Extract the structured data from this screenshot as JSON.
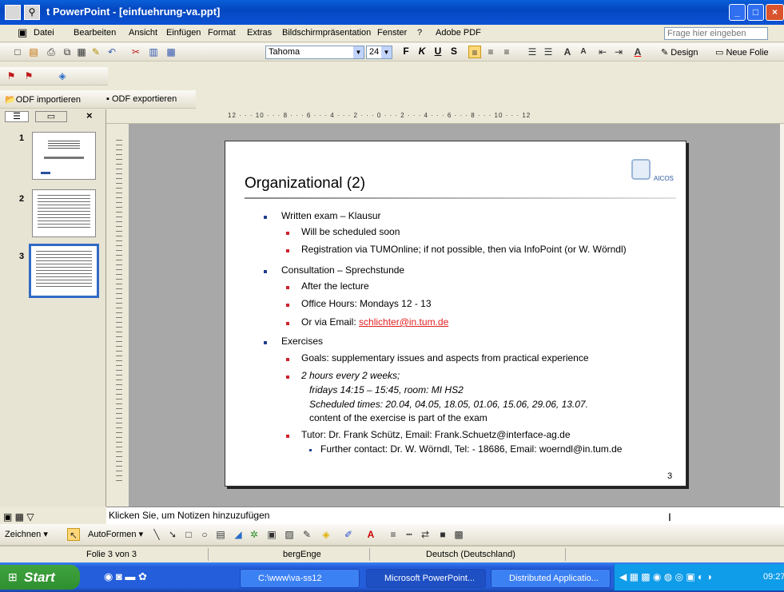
{
  "window": {
    "title": "t PowerPoint - [einfuehrung-va.ppt]"
  },
  "menu": {
    "items": [
      "Datei",
      "Bearbeiten",
      "Ansicht",
      "Einfügen",
      "Format",
      "Extras",
      "Bildschirmpräsentation",
      "Fenster",
      "?",
      "Adobe PDF"
    ],
    "help_placeholder": "Frage hier eingeben"
  },
  "format_toolbar": {
    "font": "Tahoma",
    "size": "24",
    "design_label": "Design",
    "new_slide_label": "Neue Folie"
  },
  "odf_toolbar": {
    "import_label": "ODF importieren",
    "export_label": "ODF exportieren"
  },
  "ruler": {
    "text": "12 · · · 10 · · · 8 · · · 6 · · · 4 · · · 2 · · · 0 · · · 2 · · · 4 · · · 6 · · · 8 · · · 10 · · · 12"
  },
  "thumbnails": [
    {
      "num": "1"
    },
    {
      "num": "2"
    },
    {
      "num": "3"
    }
  ],
  "slide": {
    "title": "Organizational (2)",
    "logo_text": "AICOS",
    "number": "3",
    "written_exam": "Written exam – Klausur",
    "scheduled": "Will be scheduled soon",
    "registration": "Registration via TUMOnline; if not possible, then via InfoPoint (or W. Wörndl)",
    "consultation": "Consultation – Sprechstunde",
    "after_lecture": "After the lecture",
    "office_hours": "Office Hours: Mondays 12 - 13",
    "email_prefix": "Or via Email: ",
    "email": "schlichter@in.tum.de",
    "exercises": "Exercises",
    "goals": "Goals: supplementary issues and aspects from practical experience",
    "hours": "2 hours every 2 weeks;",
    "fridays": "fridays 14:15 – 15:45, room: MI HS2",
    "scheduled_times": "Scheduled times: 20.04, 04.05, 18.05, 01.06, 15.06, 29.06, 13.07.",
    "content_part": "content of the exercise is part of the exam",
    "tutor": "Tutor: Dr. Frank Schütz, Email: Frank.Schuetz@interface-ag.de",
    "further": "Further contact: Dr. W. Wörndl, Tel: - 18686, Email: woerndl@in.tum.de"
  },
  "notes": {
    "placeholder": "Klicken Sie, um Notizen hinzuzufügen"
  },
  "draw_toolbar": {
    "draw_label": "Zeichnen",
    "autoshapes_label": "AutoFormen"
  },
  "status": {
    "slide": "Folie 3 von 3",
    "design": "bergEnge",
    "language": "Deutsch (Deutschland)"
  },
  "taskbar": {
    "start": "Start",
    "tasks": [
      "C:\\www\\va-ss12",
      "Microsoft PowerPoint...",
      "Distributed Applicatio..."
    ],
    "clock": "09:27"
  }
}
